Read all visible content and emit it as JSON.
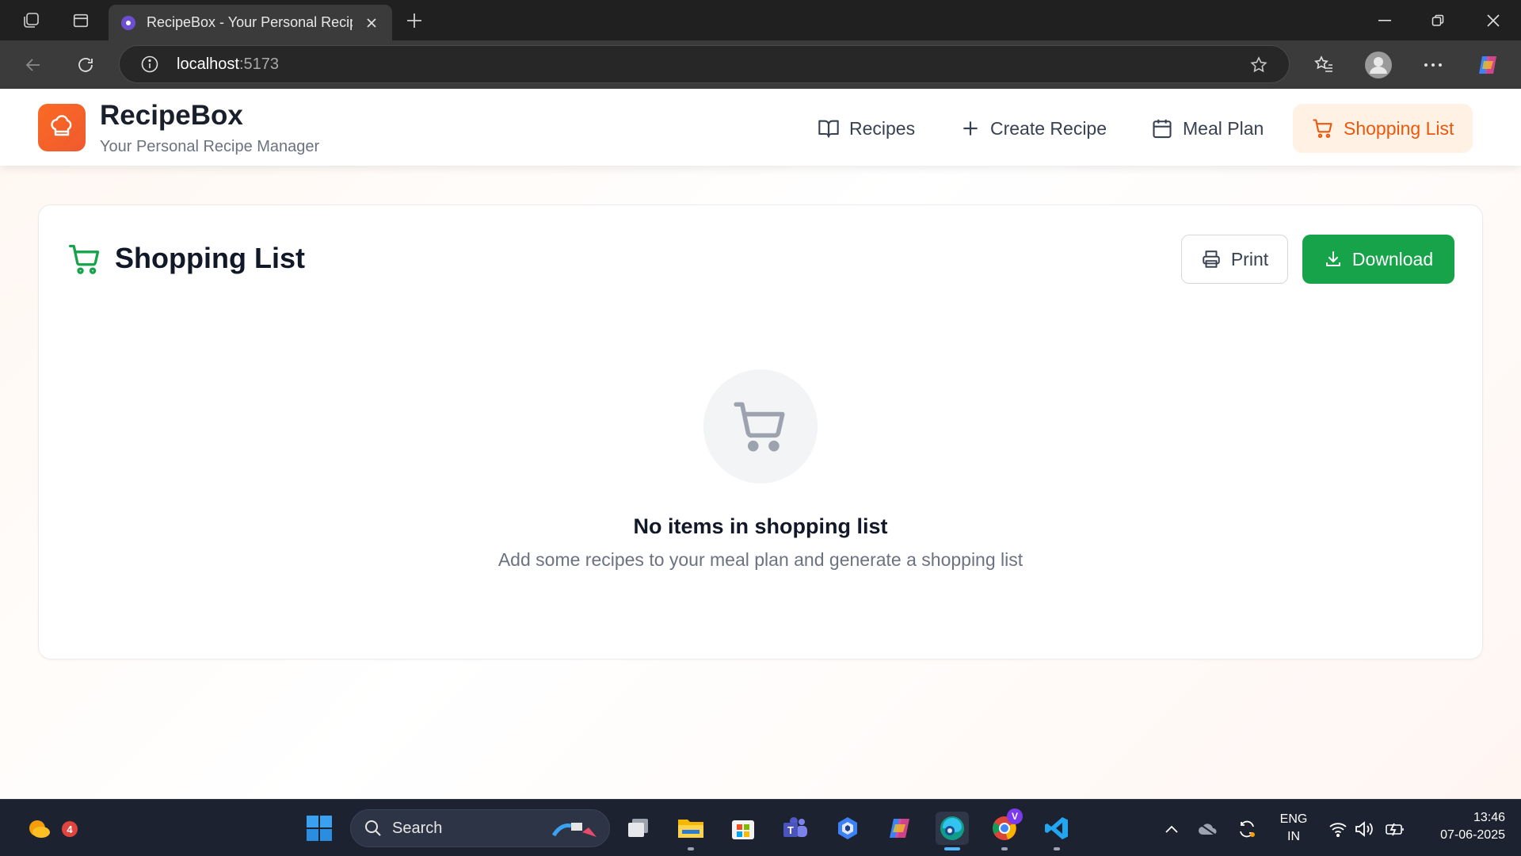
{
  "browser": {
    "tab_title": "RecipeBox - Your Personal Recipe Manager",
    "url_host": "localhost",
    "url_port": ":5173"
  },
  "header": {
    "brand_name": "RecipeBox",
    "brand_subtitle": "Your Personal Recipe Manager",
    "nav": [
      {
        "label": "Recipes",
        "icon": "book-icon",
        "active": false
      },
      {
        "label": "Create Recipe",
        "icon": "plus-icon",
        "active": false
      },
      {
        "label": "Meal Plan",
        "icon": "calendar-icon",
        "active": false
      },
      {
        "label": "Shopping List",
        "icon": "cart-icon",
        "active": true
      }
    ]
  },
  "main": {
    "title": "Shopping List",
    "print_label": "Print",
    "download_label": "Download",
    "empty_title": "No items in shopping list",
    "empty_subtitle": "Add some recipes to your meal plan and generate a shopping list"
  },
  "taskbar": {
    "search_placeholder": "Search",
    "weather_badge": "4",
    "copilot_badge": "V",
    "language": "ENG",
    "region": "IN",
    "time": "13:46",
    "date": "07-06-2025"
  },
  "colors": {
    "accent_orange": "#ea580c",
    "active_nav_bg": "#fff1e4",
    "download_green": "#16a34a",
    "cart_icon_green": "#16a34a"
  }
}
